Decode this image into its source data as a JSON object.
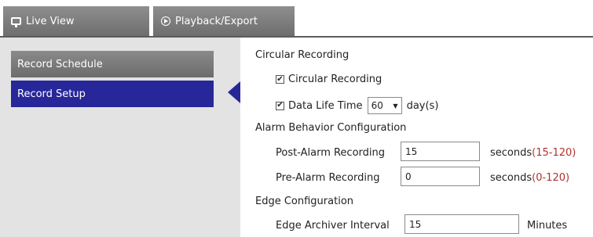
{
  "tabs": [
    {
      "label": "Live View",
      "icon": "monitor-icon"
    },
    {
      "label": "Playback/Export",
      "icon": "play-circle-icon"
    }
  ],
  "sidebar": {
    "items": [
      {
        "label": "Record Schedule",
        "active": false
      },
      {
        "label": "Record Setup",
        "active": true
      }
    ]
  },
  "circular": {
    "heading": "Circular Recording",
    "checkbox_label": "Circular Recording",
    "checked": true,
    "life_label": "Data Life Time",
    "life_checked": true,
    "life_value": "60",
    "life_unit": "day(s)"
  },
  "alarm": {
    "heading": "Alarm Behavior Configuration",
    "post_label": "Post-Alarm Recording",
    "post_value": "15",
    "post_unit": "seconds",
    "post_range": "(15-120)",
    "pre_label": "Pre-Alarm Recording",
    "pre_value": "0",
    "pre_unit": "seconds",
    "pre_range": "(0-120)"
  },
  "edge": {
    "heading": "Edge Configuration",
    "interval_label": "Edge Archiver Interval",
    "interval_value": "15",
    "interval_unit": "Minutes"
  },
  "colors": {
    "active_nav": "#27279a",
    "tab_gray": "#7a7a7a",
    "range_red": "#b23030"
  }
}
